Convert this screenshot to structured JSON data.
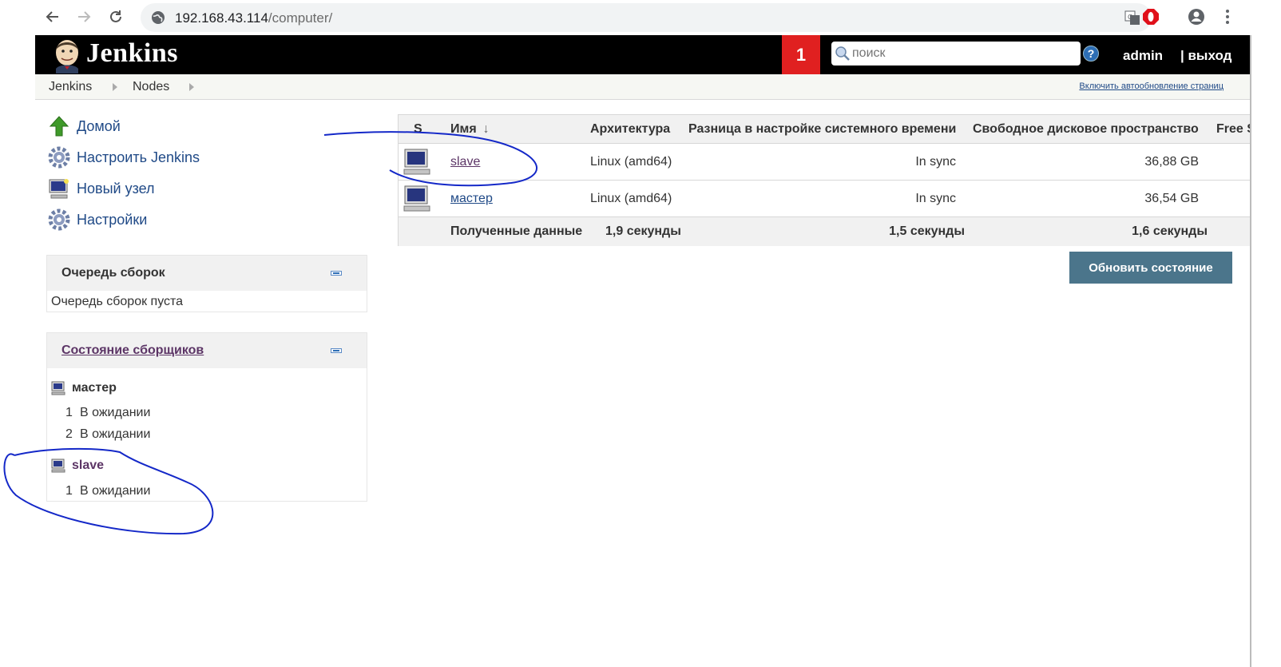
{
  "browser": {
    "url_host": "192.168.43.114",
    "url_path": "/computer/",
    "icons": [
      "back-icon",
      "forward-icon",
      "reload-icon",
      "globe-icon",
      "translate-icon",
      "opera-icon",
      "account-icon",
      "menu-icon"
    ]
  },
  "header": {
    "title": "Jenkins",
    "notification_count": "1",
    "search_placeholder": "поиск",
    "help_label": "?",
    "user": "admin",
    "logout": "| выход"
  },
  "breadcrumb": {
    "items": [
      "Jenkins",
      "Nodes"
    ],
    "autorefresh": "Включить автообновление страниц"
  },
  "sidebar": {
    "tasks": [
      {
        "label": "Домой",
        "icon": "home-arrow-icon"
      },
      {
        "label": "Настроить Jenkins",
        "icon": "gear-icon"
      },
      {
        "label": "Новый узел",
        "icon": "computer-icon"
      },
      {
        "label": "Настройки",
        "icon": "gear-icon"
      }
    ],
    "queue": {
      "title": "Очередь сборок",
      "empty_text": "Очередь сборок пуста"
    },
    "executors": {
      "title": "Состояние сборщиков",
      "nodes": [
        {
          "name": "мастер",
          "executors": [
            {
              "num": "1",
              "status": "В ожидании"
            },
            {
              "num": "2",
              "status": "В ожидании"
            }
          ]
        },
        {
          "name": "slave",
          "executors": [
            {
              "num": "1",
              "status": "В ожидании"
            }
          ]
        }
      ]
    }
  },
  "nodes_table": {
    "headers": [
      "S",
      "Имя",
      "Архитектура",
      "Разница в настройке системного времени",
      "Свободное дисковое пространство",
      "Free S"
    ],
    "sort_arrow": "↓",
    "rows": [
      {
        "name": "slave",
        "arch": "Linux (amd64)",
        "clock": "In sync",
        "disk": "36,88 GB"
      },
      {
        "name": "мастер",
        "arch": "Linux (amd64)",
        "clock": "In sync",
        "disk": "36,54 GB"
      }
    ],
    "footer": {
      "label": "Полученные данные",
      "arch_time": "1,9 секунды",
      "clock_time": "1,5 секунды",
      "disk_time": "1,6 секунды"
    },
    "refresh_button": "Обновить состояние"
  },
  "colors": {
    "header_bg": "#000000",
    "badge": "#e02020",
    "link": "#204a87",
    "visited_link": "#5c3566",
    "button": "#4b758b",
    "annotation": "#1428c8"
  }
}
